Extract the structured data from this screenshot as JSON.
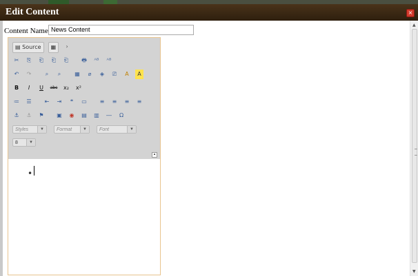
{
  "window": {
    "title": "Edit Content",
    "close_glyph": "×"
  },
  "form": {
    "content_name_label": "Content Name:",
    "content_name_value": "News Content"
  },
  "editor": {
    "source_label": "Source",
    "source_icon": "source-document-icon",
    "styles_placeholder": "Styles",
    "format_placeholder": "Format",
    "font_placeholder": "Font",
    "size_value": "8",
    "bullet": "•",
    "toolbar_glyphs": {
      "row2": [
        "✂",
        "⎘",
        "⎗",
        "⎗",
        "⎗",
        "🖶",
        "ᴬᴮ",
        "ᴬᴮ"
      ],
      "row3": [
        "↶",
        "↷",
        "⌕",
        "⌕",
        "▦",
        "⌀",
        "◈",
        "⎚",
        "A",
        "A"
      ],
      "row4": [
        "B",
        "I",
        "U",
        "abc",
        "x₂",
        "x²"
      ],
      "row5": [
        "≔",
        "☰",
        "⇤",
        "⇥",
        "❝",
        "▭",
        "≡",
        "≡",
        "≡",
        "≡"
      ],
      "row6": [
        "⚓",
        "⚓",
        "⚑",
        "▣",
        "◉",
        "▤",
        "▥",
        "―",
        "Ω"
      ]
    }
  },
  "colors": {
    "titlebar": "#3a2714",
    "editor_border": "#e8c48e",
    "toolbar_bg": "#d3d3d3",
    "close": "#d23a2c"
  }
}
